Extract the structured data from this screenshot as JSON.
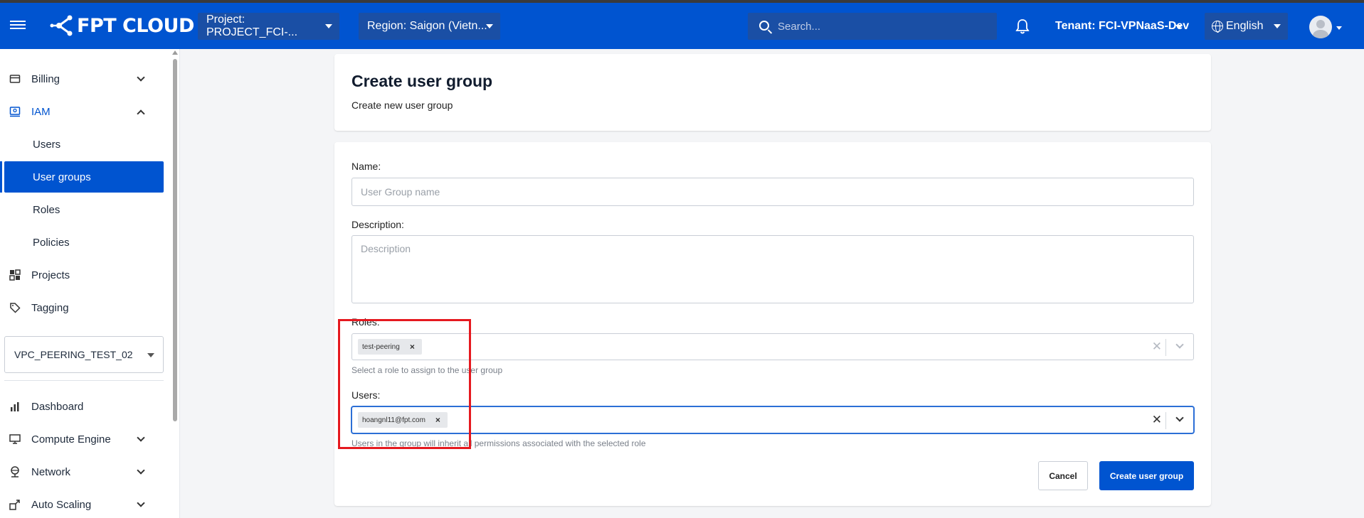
{
  "header": {
    "brand": "FPT CLOUD",
    "project_select": "Project: PROJECT_FCI-...",
    "region_select": "Region: Saigon (Vietn...",
    "search_placeholder": "Search...",
    "tenant": "Tenant: FCI-VPNaaS-Dev",
    "language": "English"
  },
  "sidebar": {
    "items": [
      {
        "label": "Billing"
      },
      {
        "label": "IAM"
      },
      {
        "label": "Users"
      },
      {
        "label": "User groups"
      },
      {
        "label": "Roles"
      },
      {
        "label": "Policies"
      },
      {
        "label": "Projects"
      },
      {
        "label": "Tagging"
      },
      {
        "label": "Dashboard"
      },
      {
        "label": "Compute Engine"
      },
      {
        "label": "Network"
      },
      {
        "label": "Auto Scaling"
      }
    ],
    "project_selector": "VPC_PEERING_TEST_02"
  },
  "page": {
    "title": "Create user group",
    "subtitle": "Create new user group"
  },
  "form": {
    "name_label": "Name:",
    "name_placeholder": "User Group name",
    "description_label": "Description:",
    "description_placeholder": "Description",
    "roles_label": "Roles:",
    "roles_selected": "test-peering",
    "roles_hint": "Select a role to assign to the user group",
    "users_label": "Users:",
    "users_selected": "hoangnl11@fpt.com",
    "users_hint": "Users in the group will inherit all permissions associated with the selected role",
    "cancel_label": "Cancel",
    "submit_label": "Create user group"
  },
  "colors": {
    "brand": "#0054d0",
    "highlight": "#e5191f"
  }
}
